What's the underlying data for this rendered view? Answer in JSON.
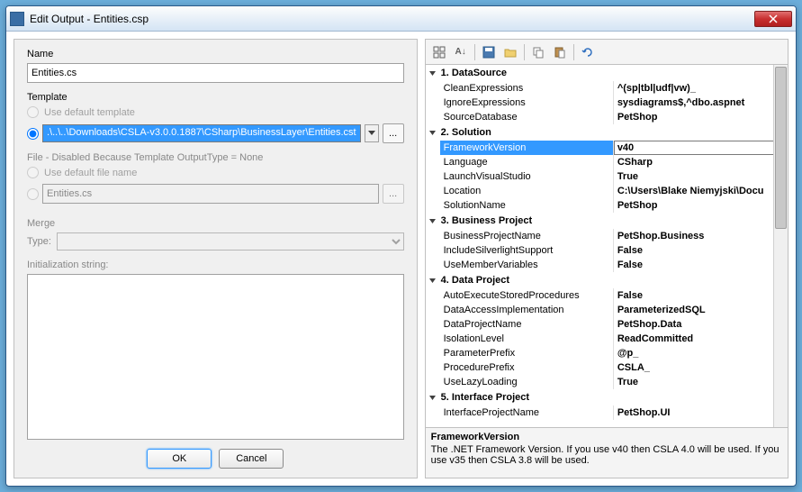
{
  "window": {
    "title": "Edit Output - Entities.csp"
  },
  "left": {
    "name_label": "Name",
    "name_value": "Entities.cs",
    "template_label": "Template",
    "use_default_template": "Use default template",
    "template_path": ".\\..\\..\\Downloads\\CSLA-v3.0.0.1887\\CSharp\\BusinessLayer\\Entities.cst",
    "file_section": "File - Disabled Because Template OutputType = None",
    "use_default_file": "Use default file name",
    "file_value": "Entities.cs",
    "merge_label": "Merge",
    "type_label": "Type:",
    "init_label": "Initialization string:",
    "ok": "OK",
    "cancel": "Cancel"
  },
  "props": {
    "cat1": "1. DataSource",
    "p1n": "CleanExpressions",
    "p1v": "^(sp|tbl|udf|vw)_",
    "p2n": "IgnoreExpressions",
    "p2v": "sysdiagrams$,^dbo.aspnet",
    "p3n": "SourceDatabase",
    "p3v": "PetShop",
    "cat2": "2. Solution",
    "p4n": "FrameworkVersion",
    "p4v": "v40",
    "p5n": "Language",
    "p5v": "CSharp",
    "p6n": "LaunchVisualStudio",
    "p6v": "True",
    "p7n": "Location",
    "p7v": "C:\\Users\\Blake Niemyjski\\Docu",
    "p8n": "SolutionName",
    "p8v": "PetShop",
    "cat3": "3. Business Project",
    "p9n": "BusinessProjectName",
    "p9v": "PetShop.Business",
    "p10n": "IncludeSilverlightSupport",
    "p10v": "False",
    "p11n": "UseMemberVariables",
    "p11v": "False",
    "cat4": "4. Data Project",
    "p12n": "AutoExecuteStoredProcedures",
    "p12v": "False",
    "p13n": "DataAccessImplementation",
    "p13v": "ParameterizedSQL",
    "p14n": "DataProjectName",
    "p14v": "PetShop.Data",
    "p15n": "IsolationLevel",
    "p15v": "ReadCommitted",
    "p16n": "ParameterPrefix",
    "p16v": "@p_",
    "p17n": "ProcedurePrefix",
    "p17v": "CSLA_",
    "p18n": "UseLazyLoading",
    "p18v": "True",
    "cat5": "5. Interface Project",
    "p19n": "InterfaceProjectName",
    "p19v": "PetShop.UI"
  },
  "desc": {
    "title": "FrameworkVersion",
    "text": "The .NET Framework Version. If you use v40 then CSLA 4.0 will be used. If you use v35 then CSLA 3.8 will be used."
  }
}
